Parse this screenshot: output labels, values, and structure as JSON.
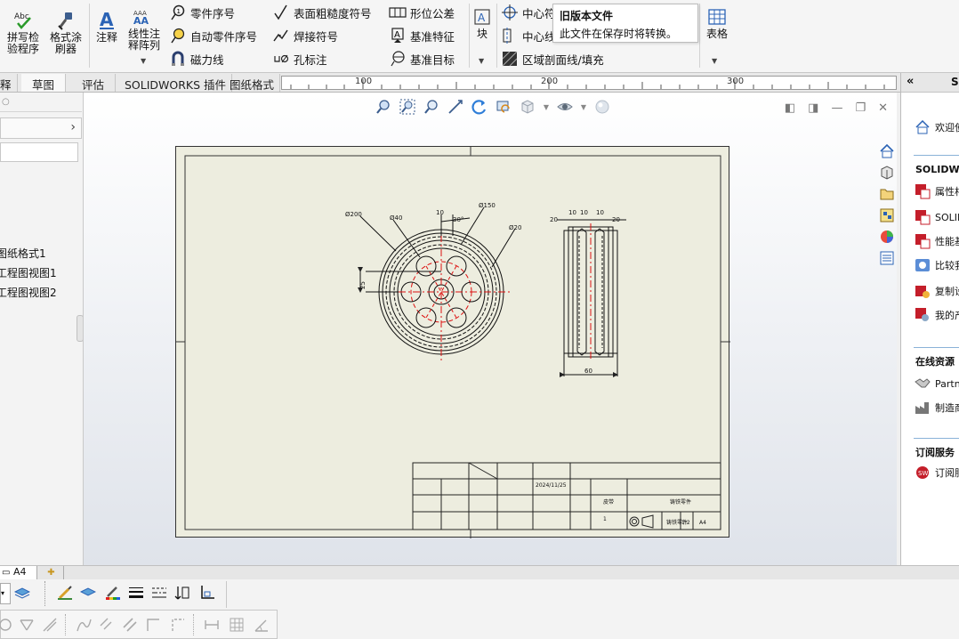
{
  "ribbon": {
    "spellcheck_label": "拼写检\n验程序",
    "spellcheck_badge": "Abc",
    "format_painter_label": "格式涂\n刷器",
    "note_label": "注释",
    "linear_pattern_label": "线性注\n释阵列",
    "linear_pattern_badge": "AAA",
    "balloon_label": "零件序号",
    "auto_balloon_label": "自动零件序号",
    "magnetic_line_label": "磁力线",
    "surface_finish_label": "表面粗糙度符号",
    "weld_symbol_label": "焊接符号",
    "hole_callout_label": "孔标注",
    "gtol_label": "形位公差",
    "datum_feature_label": "基准特征",
    "datum_target_label": "基准目标",
    "datum_letter": "A",
    "block_label": "块",
    "centermark_label": "中心符",
    "centerline_label": "中心线",
    "area_hatch_label": "区域剖面线/填充",
    "tables_label": "表格"
  },
  "tooltip": {
    "title": "旧版本文件",
    "body": "此文件在保存时将转换。"
  },
  "tabs": {
    "partial": "释",
    "sketch": "草图",
    "evaluate": "评估",
    "addins": "SOLIDWORKS 插件",
    "sheet_format": "图纸格式"
  },
  "ruler": {
    "labels": [
      "100",
      "200",
      "300"
    ]
  },
  "tree": {
    "items": [
      "图纸格式1",
      "工程图视图1",
      "工程图视图2"
    ]
  },
  "rightpane": {
    "header": "SO",
    "welcome": "欢迎使",
    "section_solidworks": "SOLIDWOR",
    "items_solidworks": [
      "属性相",
      "SOLID",
      "性能基",
      "比较我",
      "复制设",
      "我的产"
    ],
    "section_online": "在线资源",
    "items_online": [
      "Partn",
      "制造商"
    ],
    "section_subscription": "订阅服务",
    "items_subscription": [
      "订阅服"
    ]
  },
  "sheettabs": {
    "sheet_name": "A4"
  },
  "drawing": {
    "dims": {
      "d200": "Ø200",
      "d40": "Ø40",
      "d150": "Ø150",
      "d20": "Ø20",
      "angle": "30°",
      "r40": "40",
      "w10a": "10",
      "w10b": "10",
      "w10c": "10",
      "w10d": "10",
      "w20a": "20",
      "w20b": "20",
      "w60": "60",
      "r25": "25"
    },
    "titleblock": {
      "date": "2024/11/25",
      "part_name": "皮带",
      "material": "铸铁零件",
      "company": "铸铁零件",
      "scale": "1:2",
      "qty": "1",
      "sheet": "A4"
    }
  }
}
